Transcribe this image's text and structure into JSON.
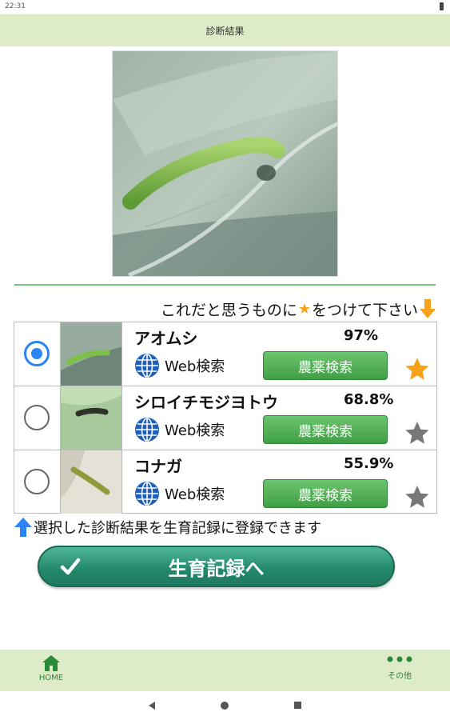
{
  "status_bar": {
    "time": "22:31"
  },
  "app_bar": {
    "title": "診断結果"
  },
  "instruction": {
    "prefix": "これだと思うものに",
    "star": "★",
    "suffix": "をつけて下さい"
  },
  "results": [
    {
      "name": "アオムシ",
      "percent": "97%",
      "selected": true,
      "web_label": "Web検索",
      "pesticide_label": "農薬検索",
      "favorite": true
    },
    {
      "name": "シロイチモジヨトウ",
      "percent": "68.8%",
      "selected": false,
      "web_label": "Web検索",
      "pesticide_label": "農薬検索",
      "favorite": false
    },
    {
      "name": "コナガ",
      "percent": "55.9%",
      "selected": false,
      "web_label": "Web検索",
      "pesticide_label": "農薬検索",
      "favorite": false
    }
  ],
  "hint": {
    "text": "選択した診断結果を生育記録に登録できます"
  },
  "record_button": {
    "label": "生育記録へ"
  },
  "bottom_nav": {
    "home_label": "HOME",
    "more_label": "その他"
  },
  "colors": {
    "accent_green": "#3f9f45",
    "header_bg": "#deebc8",
    "radio_blue": "#2a84f5",
    "star_orange": "#f7a21b",
    "star_gray": "#777777",
    "record_teal": "#23876a"
  }
}
